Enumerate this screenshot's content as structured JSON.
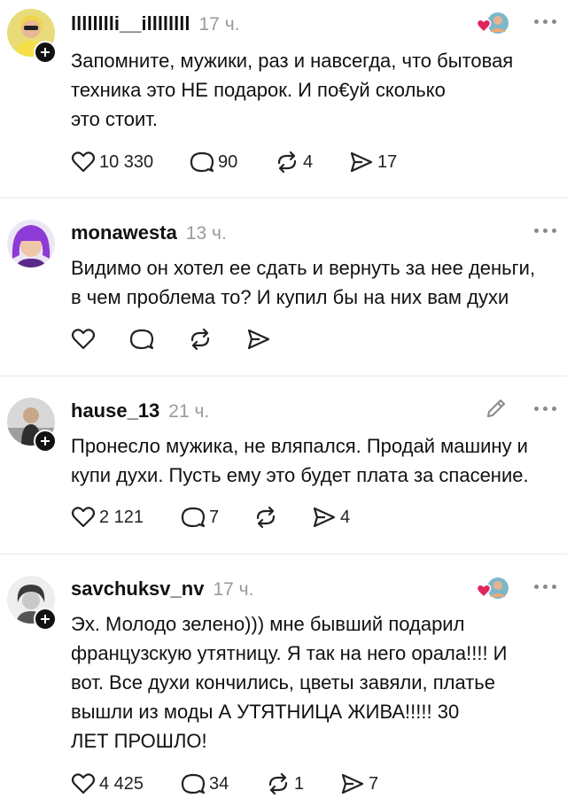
{
  "posts": [
    {
      "username": "lllllllli__illllllll",
      "time": "17 ч.",
      "text": "Запомните, мужики, раз и навсегда, что бытовая\nтехника это НЕ подарок. И по€уй сколько\nэто стоит.",
      "likes": "10 330",
      "comments": "90",
      "reposts": "4",
      "shares": "17"
    },
    {
      "username": "monawesta",
      "time": "13 ч.",
      "text": "Видимо он хотел ее сдать и вернуть за нее деньги,\nв чем проблема то? И купил бы на них вам духи",
      "likes": "",
      "comments": "",
      "reposts": "",
      "shares": ""
    },
    {
      "username": "hause_13",
      "time": "21 ч.",
      "text": "Пронесло мужика, не вляпался. Продай машину и\nкупи духи. Пусть ему это будет плата за спасение.",
      "likes": "2 121",
      "comments": "7",
      "reposts": "",
      "shares": "4"
    },
    {
      "username": "savchuksv_nv",
      "time": "17 ч.",
      "text": "Эх. Молодо зелено))) мне бывший подарил\nфранцузскую утятницу. Я так на него орала!!!! И\nвот. Все духи кончились, цветы завяли, платье\nвышли из моды А УТЯТНИЦА ЖИВА!!!!! 30\nЛЕТ ПРОШЛО!",
      "likes": "4 425",
      "comments": "34",
      "reposts": "1",
      "shares": "7"
    }
  ],
  "colors": {
    "heart_red": "#e0245e",
    "divider": "#e6e6e6",
    "muted": "#9a9a9a"
  },
  "icons": [
    "follow-plus-icon",
    "heart-icon",
    "comment-icon",
    "repost-icon",
    "share-icon",
    "more-icon",
    "edit-pencil-icon"
  ]
}
